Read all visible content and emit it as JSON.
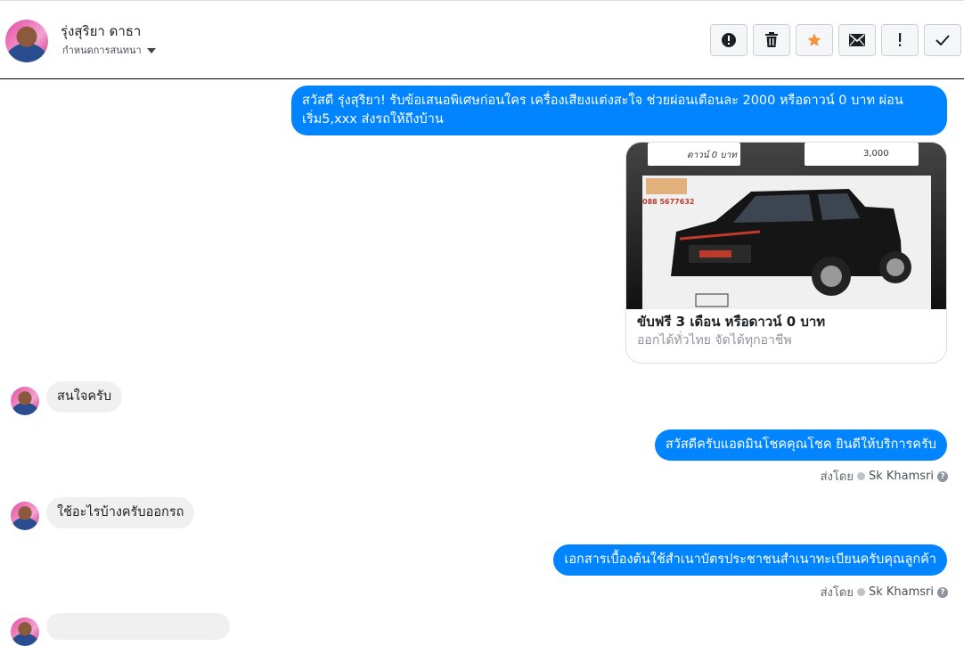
{
  "header": {
    "contact_name": "รุ่งสุริยา ดาธา",
    "conversation_settings": "กำหนดการสนทนา",
    "toolbar": [
      {
        "name": "report-button",
        "icon": "exclamation-circle-icon"
      },
      {
        "name": "delete-button",
        "icon": "trash-icon"
      },
      {
        "name": "star-button",
        "icon": "star-icon"
      },
      {
        "name": "mark-unread-button",
        "icon": "envelope-icon"
      },
      {
        "name": "mark-spam-button",
        "icon": "exclamation-icon"
      },
      {
        "name": "mark-done-button",
        "icon": "check-icon"
      }
    ]
  },
  "messages": {
    "m1_text": "สวัสดี รุ่งสุริยา! รับข้อเสนอพิเศษก่อนใคร เครื่องเสียงแต่งสะใจ ช่วยผ่อนเดือนละ 2000 หรือดาวน์ 0 บาท ผ่อนเริ่ม5,xxx ส่งรถให้ถึงบ้าน",
    "card": {
      "title": "ขับฟรี 3 เดือน หรือดาวน์ 0 บาท",
      "subtitle": "ออกได้ทั่วไทย จัดได้ทุกอาชีพ",
      "img_label_left": "ดาวน์ 0 บาท",
      "img_label_right": "3,000",
      "img_phone": "088 5677632"
    },
    "m2_text": "สนใจครับ",
    "m3_text": "สวัสดีครับแอดมินโชคคุณโชค ยินดีให้บริการครับ",
    "m3_sent_prefix": "ส่งโดย",
    "m3_sender": "Sk Khamsri",
    "m4_text": "ใช้อะไรบ้างครับออกรถ",
    "m5_text": "เอกสารเบื้องต้นใช้สำเนาบัตรประชาชนสำเนาทะเบียนครับคุณลูกค้า",
    "m5_sent_prefix": "ส่งโดย",
    "m5_sender": "Sk Khamsri"
  },
  "colors": {
    "outgoing": "#0084ff",
    "incoming": "#f1f0f0",
    "star": "#f7923b"
  }
}
